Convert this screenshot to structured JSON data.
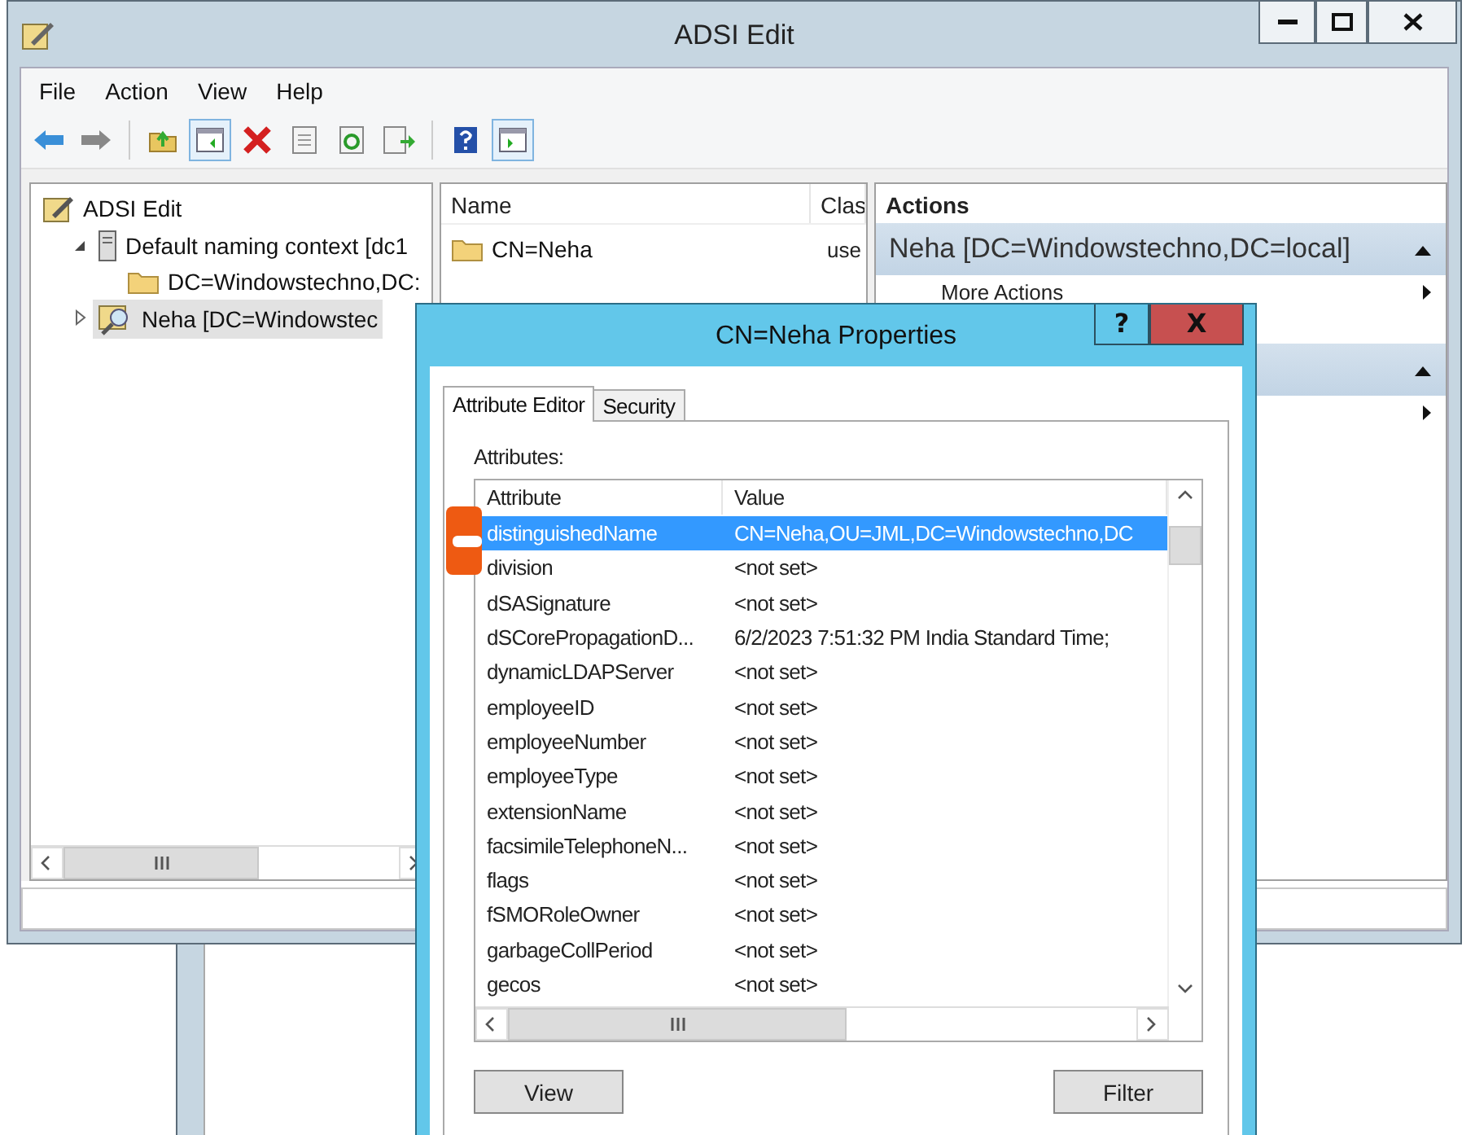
{
  "window": {
    "title": "ADSI Edit"
  },
  "menu": [
    "File",
    "Action",
    "View",
    "Help"
  ],
  "tree": [
    {
      "label": "ADSI Edit",
      "kind": "root",
      "selected": false,
      "children": [
        {
          "label": "Default naming context [dc1",
          "kind": "server",
          "expanded": true,
          "selected": false,
          "children": [
            {
              "label": "DC=Windowstechno,DC:",
              "kind": "folder",
              "selected": false
            }
          ]
        },
        {
          "label": "Neha [DC=Windowstec",
          "kind": "search",
          "expanded": false,
          "selected": true
        }
      ]
    }
  ],
  "list": {
    "columns": [
      "Name",
      "Clas"
    ],
    "rows": [
      {
        "name": "CN=Neha",
        "class": "use"
      }
    ]
  },
  "actions": {
    "header": "Actions",
    "groups": [
      {
        "title": "Neha [DC=Windowstechno,DC=local]",
        "expanded": true,
        "items": [
          {
            "label": "More Actions",
            "submenu": true
          }
        ]
      },
      {
        "expanded": true,
        "items": [
          {
            "submenu": true
          }
        ]
      }
    ]
  },
  "dialog": {
    "title": "CN=Neha Properties",
    "help": "?",
    "close": "X",
    "tabs": [
      {
        "label": "Attribute Editor",
        "selected": true
      },
      {
        "label": "Security",
        "selected": false
      }
    ],
    "attributes_label": "Attributes:",
    "columns": [
      "Attribute",
      "Value"
    ],
    "rows": [
      {
        "attribute": "distinguishedName",
        "value": "CN=Neha,OU=JML,DC=Windowstechno,DC",
        "selected": true
      },
      {
        "attribute": "division",
        "value": "<not set>",
        "selected": false
      },
      {
        "attribute": "dSASignature",
        "value": "<not set>",
        "selected": false
      },
      {
        "attribute": "dSCorePropagationD...",
        "value": "6/2/2023 7:51:32 PM India Standard Time;",
        "selected": false
      },
      {
        "attribute": "dynamicLDAPServer",
        "value": "<not set>",
        "selected": false
      },
      {
        "attribute": "employeeID",
        "value": "<not set>",
        "selected": false
      },
      {
        "attribute": "employeeNumber",
        "value": "<not set>",
        "selected": false
      },
      {
        "attribute": "employeeType",
        "value": "<not set>",
        "selected": false
      },
      {
        "attribute": "extensionName",
        "value": "<not set>",
        "selected": false
      },
      {
        "attribute": "facsimileTelephoneN...",
        "value": "<not set>",
        "selected": false
      },
      {
        "attribute": "flags",
        "value": "<not set>",
        "selected": false
      },
      {
        "attribute": "fSMORoleOwner",
        "value": "<not set>",
        "selected": false
      },
      {
        "attribute": "garbageCollPeriod",
        "value": "<not set>",
        "selected": false
      },
      {
        "attribute": "gecos",
        "value": "<not set>",
        "selected": false
      }
    ],
    "buttons": [
      "View",
      "Filter"
    ]
  }
}
